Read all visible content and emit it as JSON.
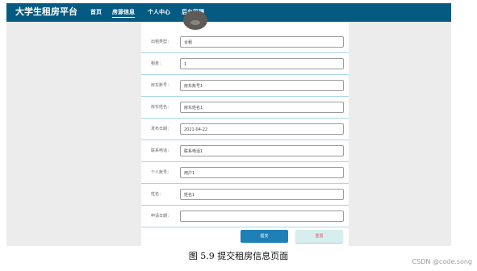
{
  "navbar": {
    "brand": "大学生租房平台",
    "items": [
      {
        "label": "首页",
        "active": false
      },
      {
        "label": "房源信息",
        "active": true
      },
      {
        "label": "个人中心",
        "active": false
      },
      {
        "label": "后台管理",
        "active": false
      }
    ]
  },
  "form": {
    "fields": [
      {
        "label": "出租类型：",
        "value": "合租"
      },
      {
        "label": "租金：",
        "value": "1"
      },
      {
        "label": "房东账号：",
        "value": "房东账号1"
      },
      {
        "label": "房东姓名：",
        "value": "房东姓名1"
      },
      {
        "label": "发布日期：",
        "value": "2021-04-22"
      },
      {
        "label": "联系电话：",
        "value": "联系电话1"
      },
      {
        "label": "个人账号：",
        "value": "用户1"
      },
      {
        "label": "姓名：",
        "value": "姓名1"
      },
      {
        "label": "申请日期：",
        "value": ""
      }
    ],
    "submit_label": "提交",
    "reset_label": "重置"
  },
  "caption": "图 5.9  提交租房信息页面",
  "watermark": "CSDN @code.song",
  "colors": {
    "navbar": "#055a82",
    "divider": "#a9d6e6",
    "submit": "#1f80b8",
    "reset_bg": "#d7eeee",
    "reset_text": "#d65b5b"
  }
}
